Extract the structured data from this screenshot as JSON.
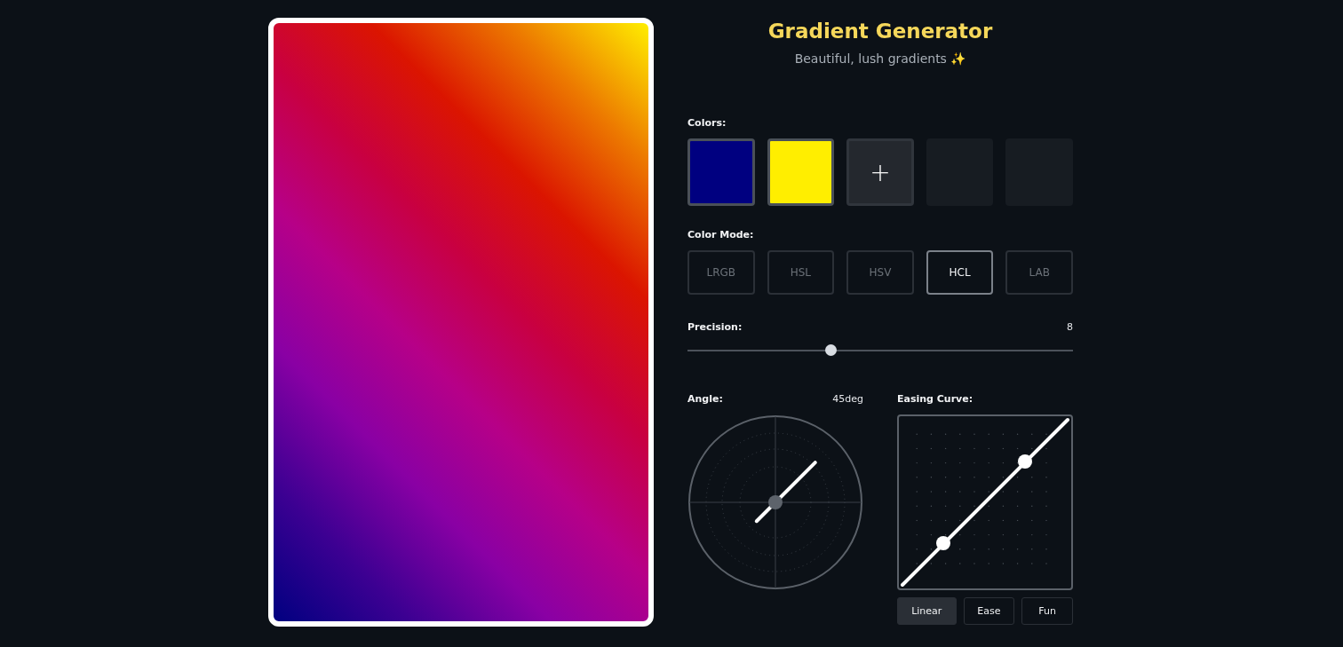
{
  "header": {
    "title": "Gradient Generator",
    "subtitle": "Beautiful, lush gradients ✨"
  },
  "colors": {
    "label": "Colors:",
    "slots": [
      {
        "kind": "color",
        "color": "#000080"
      },
      {
        "kind": "color",
        "color": "#ffee00"
      },
      {
        "kind": "add",
        "text": "+"
      },
      {
        "kind": "empty"
      },
      {
        "kind": "empty"
      }
    ]
  },
  "color_mode": {
    "label": "Color Mode:",
    "options": [
      {
        "label": "LRGB",
        "selected": false
      },
      {
        "label": "HSL",
        "selected": false
      },
      {
        "label": "HSV",
        "selected": false
      },
      {
        "label": "HCL",
        "selected": true
      },
      {
        "label": "LAB",
        "selected": false
      }
    ]
  },
  "precision": {
    "label": "Precision:",
    "reading": "8",
    "level": 0.37
  },
  "angle": {
    "label": "Angle:",
    "reading": "45deg"
  },
  "easing": {
    "label": "Easing Curve:",
    "presets": [
      {
        "label": "Linear",
        "selected": true
      },
      {
        "label": "Ease",
        "selected": false
      },
      {
        "label": "Fun",
        "selected": false
      }
    ]
  }
}
